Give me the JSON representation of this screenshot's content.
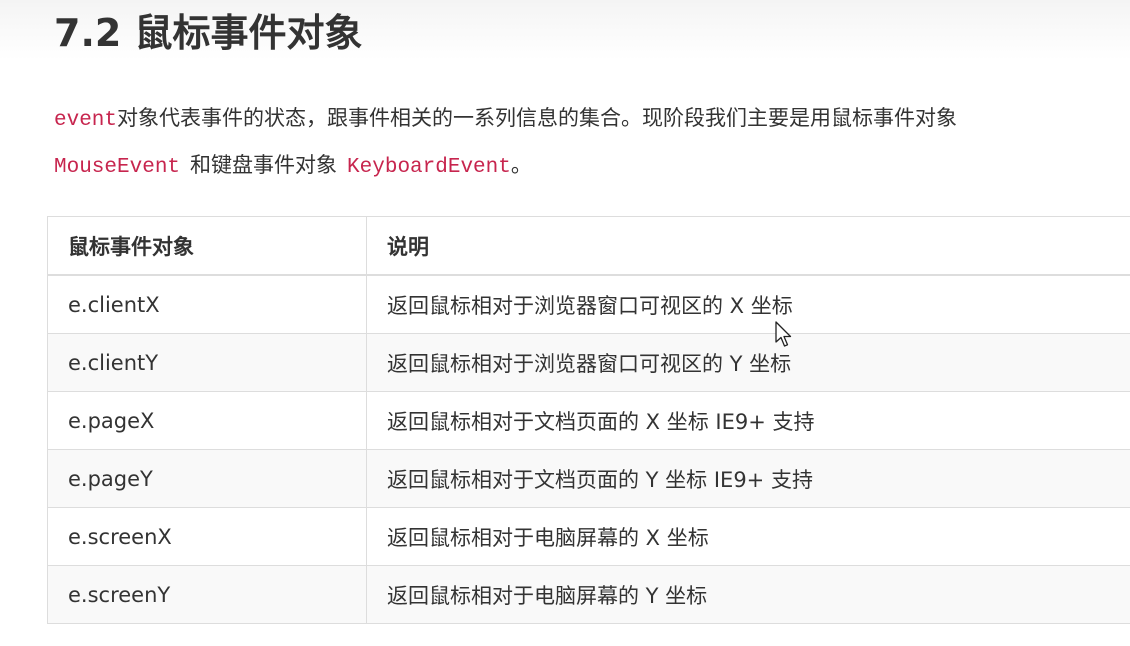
{
  "heading": "7.2 鼠标事件对象",
  "intro": {
    "code_event": "event",
    "text_1": "对象代表事件的状态，跟事件相关的一系列信息的集合。现阶段我们主要是用鼠标事件对象",
    "code_mouse": "MouseEvent",
    "text_2": "和键盘事件对象",
    "code_keyboard": "KeyboardEvent",
    "text_3": "。"
  },
  "table": {
    "headers": [
      "鼠标事件对象",
      "说明"
    ],
    "rows": [
      [
        "e.clientX",
        "返回鼠标相对于浏览器窗口可视区的 X 坐标"
      ],
      [
        "e.clientY",
        "返回鼠标相对于浏览器窗口可视区的 Y 坐标"
      ],
      [
        "e.pageX",
        "返回鼠标相对于文档页面的 X 坐标  IE9+ 支持"
      ],
      [
        "e.pageY",
        "返回鼠标相对于文档页面的 Y 坐标  IE9+ 支持"
      ],
      [
        "e.screenX",
        "返回鼠标相对于电脑屏幕的 X 坐标"
      ],
      [
        "e.screenY",
        "返回鼠标相对于电脑屏幕的 Y 坐标"
      ]
    ]
  },
  "colors": {
    "code": "#c7254e",
    "text": "#333333",
    "border": "#dddddd",
    "row_alt": "#f9f9f9"
  },
  "icons": {
    "cursor": "mouse-pointer-icon"
  }
}
